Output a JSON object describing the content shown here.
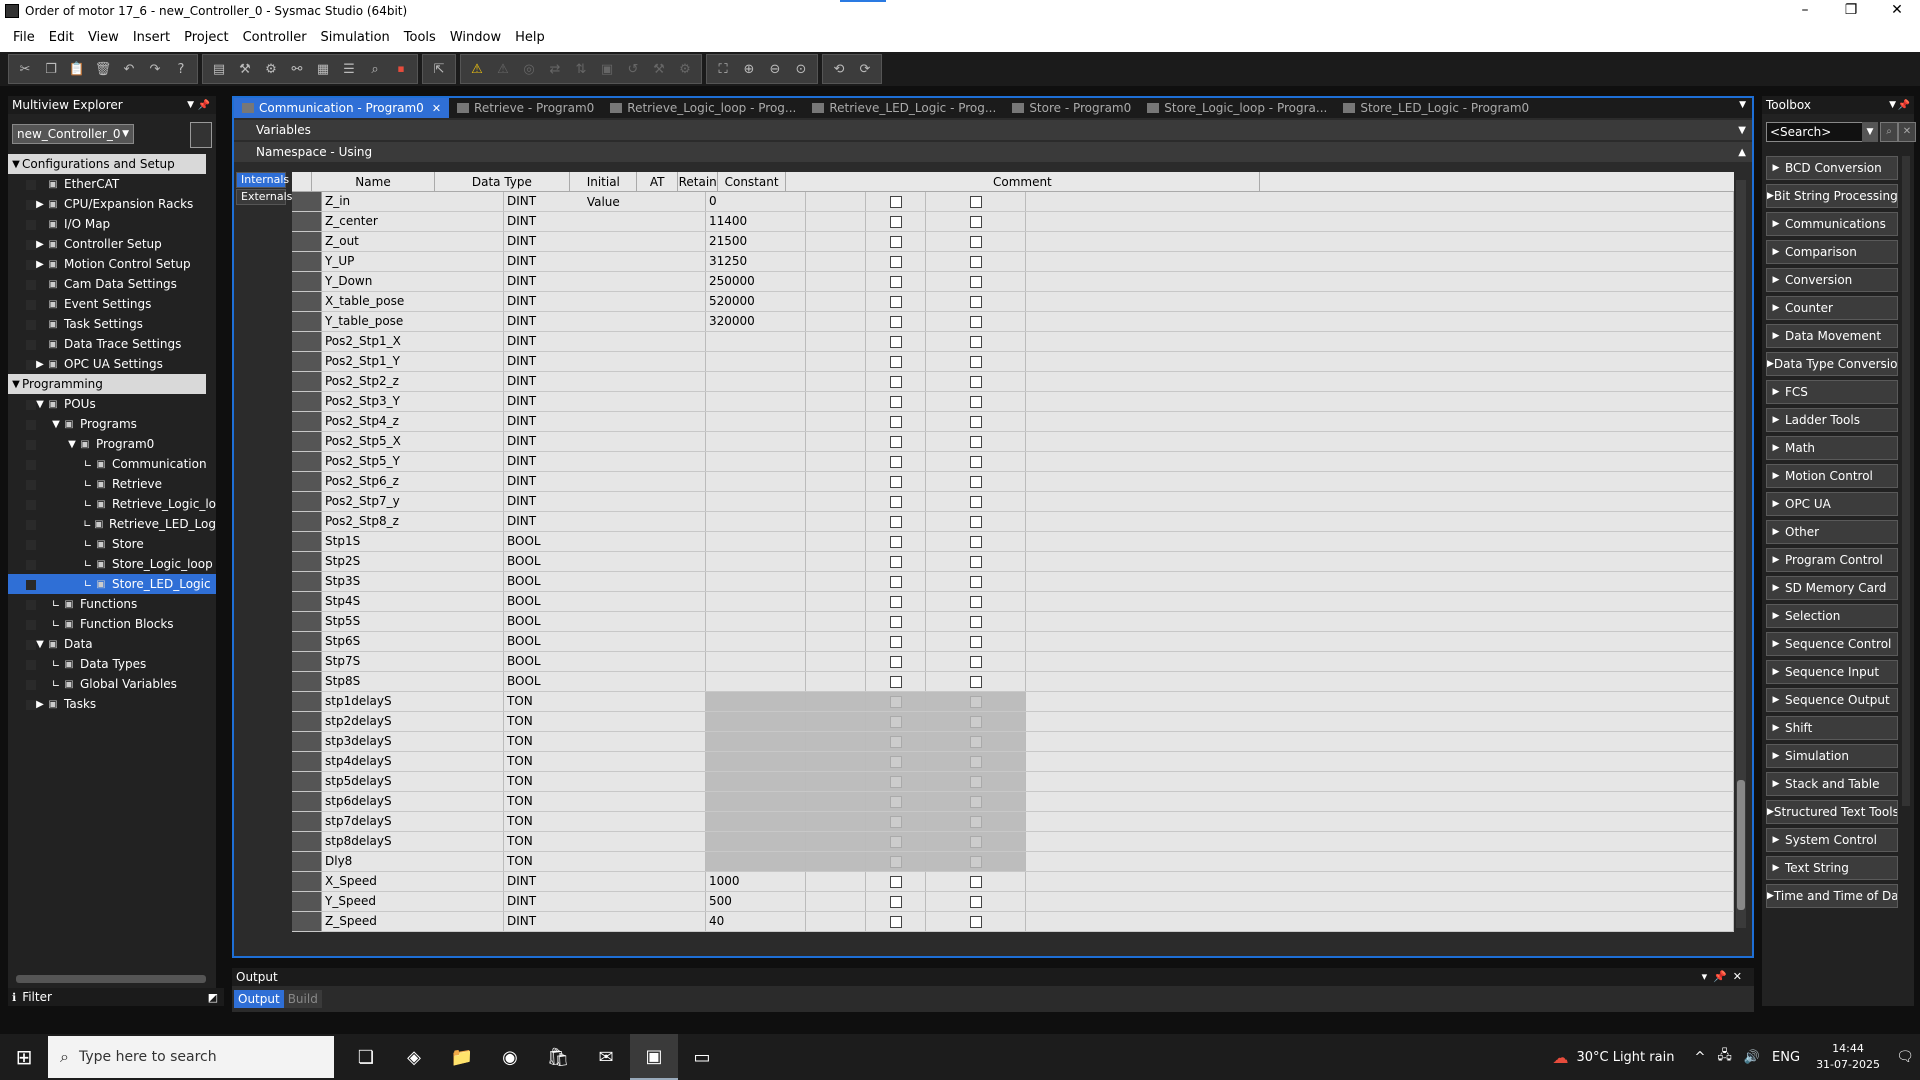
{
  "window": {
    "title": "Order of motor 17_6 - new_Controller_0 - Sysmac Studio (64bit)",
    "minimize": "–",
    "maximize": "❐",
    "close": "✕"
  },
  "menu": [
    "File",
    "Edit",
    "View",
    "Insert",
    "Project",
    "Controller",
    "Simulation",
    "Tools",
    "Window",
    "Help"
  ],
  "toolbar": {
    "group1": [
      "cut-icon",
      "copy-icon",
      "paste-icon",
      "delete-icon",
      "undo-icon",
      "redo-icon",
      "help-icon"
    ],
    "group2": [
      "dictionary-icon",
      "build-icon",
      "tool-icon",
      "cross-ref-icon",
      "memory-icon",
      "variable-icon",
      "find-icon",
      "stop-icon"
    ],
    "group3": [
      "online-icon"
    ],
    "group4": [
      "warning-icon",
      "force-icon",
      "monitor-icon",
      "sync-icon",
      "transfer-icon",
      "compare-icon",
      "reset-icon",
      "wrench-icon",
      "settings-icon"
    ],
    "group5": [
      "zoom-fit-icon",
      "zoom-in-icon",
      "zoom-out-icon",
      "zoom-reset-icon"
    ],
    "group6": [
      "nav-back-icon",
      "nav-forward-icon"
    ]
  },
  "explorer": {
    "title": "Multiview Explorer",
    "controller": "new_Controller_0",
    "tree": [
      {
        "label": "Configurations and Setup",
        "level": 0,
        "exp": "▼",
        "hdr": true
      },
      {
        "label": "EtherCAT",
        "level": 1,
        "exp": "",
        "icon": "ethercat-icon"
      },
      {
        "label": "CPU/Expansion Racks",
        "level": 1,
        "exp": "▶",
        "icon": "rack-icon"
      },
      {
        "label": "I/O Map",
        "level": 1,
        "exp": "",
        "icon": "io-map-icon"
      },
      {
        "label": "Controller Setup",
        "level": 1,
        "exp": "▶",
        "icon": "controller-setup-icon"
      },
      {
        "label": "Motion Control Setup",
        "level": 1,
        "exp": "▶",
        "icon": "motion-gear-icon"
      },
      {
        "label": "Cam Data Settings",
        "level": 1,
        "exp": "",
        "icon": "cam-icon"
      },
      {
        "label": "Event Settings",
        "level": 1,
        "exp": "",
        "icon": "flag-icon"
      },
      {
        "label": "Task Settings",
        "level": 1,
        "exp": "",
        "icon": "task-icon"
      },
      {
        "label": "Data Trace Settings",
        "level": 1,
        "exp": "",
        "icon": "trace-icon"
      },
      {
        "label": "OPC UA Settings",
        "level": 1,
        "exp": "▶",
        "icon": "opcua-icon"
      },
      {
        "label": "Programming",
        "level": 0,
        "exp": "▼",
        "hdr": true
      },
      {
        "label": "POUs",
        "level": 1,
        "exp": "▼",
        "icon": "pou-icon"
      },
      {
        "label": "Programs",
        "level": 2,
        "exp": "▼",
        "icon": "programs-icon"
      },
      {
        "label": "Program0",
        "level": 3,
        "exp": "▼",
        "icon": "program-icon"
      },
      {
        "label": "Communication",
        "level": 4,
        "exp": "",
        "icon": "section-icon"
      },
      {
        "label": "Retrieve",
        "level": 4,
        "exp": "",
        "icon": "section-icon"
      },
      {
        "label": "Retrieve_Logic_lo",
        "level": 4,
        "exp": "",
        "icon": "section-icon"
      },
      {
        "label": "Retrieve_LED_Log",
        "level": 4,
        "exp": "",
        "icon": "section-icon"
      },
      {
        "label": "Store",
        "level": 4,
        "exp": "",
        "icon": "section-icon"
      },
      {
        "label": "Store_Logic_loop",
        "level": 4,
        "exp": "",
        "icon": "section-icon"
      },
      {
        "label": "Store_LED_Logic",
        "level": 4,
        "exp": "",
        "icon": "section-icon",
        "sel": true
      },
      {
        "label": "Functions",
        "level": 2,
        "exp": "",
        "icon": "functions-icon"
      },
      {
        "label": "Function Blocks",
        "level": 2,
        "exp": "",
        "icon": "function-blocks-icon"
      },
      {
        "label": "Data",
        "level": 1,
        "exp": "▼",
        "icon": "data-icon"
      },
      {
        "label": "Data Types",
        "level": 2,
        "exp": "",
        "icon": "data-types-icon"
      },
      {
        "label": "Global Variables",
        "level": 2,
        "exp": "",
        "icon": "global-vars-icon"
      },
      {
        "label": "Tasks",
        "level": 1,
        "exp": "▶",
        "icon": "tasks-icon"
      }
    ],
    "filter": "Filter"
  },
  "tabs": [
    {
      "label": "Communication - Program0",
      "active": true
    },
    {
      "label": "Retrieve - Program0"
    },
    {
      "label": "Retrieve_Logic_loop - Prog..."
    },
    {
      "label": "Retrieve_LED_Logic - Prog..."
    },
    {
      "label": "Store - Program0"
    },
    {
      "label": "Store_Logic_loop - Progra..."
    },
    {
      "label": "Store_LED_Logic - Program0"
    }
  ],
  "variables_header": "Variables",
  "namespace_header": "Namespace - Using",
  "side_tabs": [
    "Internals",
    "Externals"
  ],
  "columns": [
    "Name",
    "Data Type",
    "Initial Value",
    "AT",
    "Retain",
    "Constant",
    "Comment"
  ],
  "rows": [
    {
      "name": "Z_in",
      "type": "DINT",
      "init": "0"
    },
    {
      "name": "Z_center",
      "type": "DINT",
      "init": "11400"
    },
    {
      "name": "Z_out",
      "type": "DINT",
      "init": "21500"
    },
    {
      "name": "Y_UP",
      "type": "DINT",
      "init": "31250"
    },
    {
      "name": "Y_Down",
      "type": "DINT",
      "init": "250000"
    },
    {
      "name": "X_table_pose",
      "type": "DINT",
      "init": "520000"
    },
    {
      "name": "Y_table_pose",
      "type": "DINT",
      "init": "320000"
    },
    {
      "name": "Pos2_Stp1_X",
      "type": "DINT",
      "init": ""
    },
    {
      "name": "Pos2_Stp1_Y",
      "type": "DINT",
      "init": ""
    },
    {
      "name": "Pos2_Stp2_z",
      "type": "DINT",
      "init": ""
    },
    {
      "name": "Pos2_Stp3_Y",
      "type": "DINT",
      "init": ""
    },
    {
      "name": "Pos2_Stp4_z",
      "type": "DINT",
      "init": ""
    },
    {
      "name": "Pos2_Stp5_X",
      "type": "DINT",
      "init": ""
    },
    {
      "name": "Pos2_Stp5_Y",
      "type": "DINT",
      "init": ""
    },
    {
      "name": "Pos2_Stp6_z",
      "type": "DINT",
      "init": ""
    },
    {
      "name": "Pos2_Stp7_y",
      "type": "DINT",
      "init": ""
    },
    {
      "name": "Pos2_Stp8_z",
      "type": "DINT",
      "init": ""
    },
    {
      "name": "Stp1S",
      "type": "BOOL",
      "init": ""
    },
    {
      "name": "Stp2S",
      "type": "BOOL",
      "init": ""
    },
    {
      "name": "Stp3S",
      "type": "BOOL",
      "init": ""
    },
    {
      "name": "Stp4S",
      "type": "BOOL",
      "init": ""
    },
    {
      "name": "Stp5S",
      "type": "BOOL",
      "init": ""
    },
    {
      "name": "Stp6S",
      "type": "BOOL",
      "init": ""
    },
    {
      "name": "Stp7S",
      "type": "BOOL",
      "init": ""
    },
    {
      "name": "Stp8S",
      "type": "BOOL",
      "init": ""
    },
    {
      "name": "stp1delayS",
      "type": "TON",
      "init": ""
    },
    {
      "name": "stp2delayS",
      "type": "TON",
      "init": ""
    },
    {
      "name": "stp3delayS",
      "type": "TON",
      "init": ""
    },
    {
      "name": "stp4delayS",
      "type": "TON",
      "init": ""
    },
    {
      "name": "stp5delayS",
      "type": "TON",
      "init": ""
    },
    {
      "name": "stp6delayS",
      "type": "TON",
      "init": ""
    },
    {
      "name": "stp7delayS",
      "type": "TON",
      "init": ""
    },
    {
      "name": "stp8delayS",
      "type": "TON",
      "init": ""
    },
    {
      "name": "Dly8",
      "type": "TON",
      "init": ""
    },
    {
      "name": "X_Speed",
      "type": "DINT",
      "init": "1000"
    },
    {
      "name": "Y_Speed",
      "type": "DINT",
      "init": "500"
    },
    {
      "name": "Z_Speed",
      "type": "DINT",
      "init": "40"
    }
  ],
  "output": {
    "title": "Output",
    "tabs": [
      "Output",
      "Build"
    ]
  },
  "toolbox": {
    "title": "Toolbox",
    "search_placeholder": "<Search>",
    "categories": [
      "BCD Conversion",
      "Bit String Processing",
      "Communications",
      "Comparison",
      "Conversion",
      "Counter",
      "Data Movement",
      "Data Type Conversio",
      "FCS",
      "Ladder Tools",
      "Math",
      "Motion Control",
      "OPC UA",
      "Other",
      "Program Control",
      "SD Memory Card",
      "Selection",
      "Sequence Control",
      "Sequence Input",
      "Sequence Output",
      "Shift",
      "Simulation",
      "Stack and Table",
      "Structured Text Tools",
      "System Control",
      "Text String",
      "Time and Time of Da"
    ]
  },
  "taskbar": {
    "search_placeholder": "Type here to search",
    "apps": [
      "task-view-icon",
      "copilot-icon",
      "file-explorer-icon",
      "edge-icon",
      "store-icon",
      "outlook-icon",
      "sysmac-icon",
      "app-icon"
    ],
    "weather": "30°C  Light rain",
    "lang": "ENG",
    "time": "14:44",
    "date": "31-07-2025"
  }
}
